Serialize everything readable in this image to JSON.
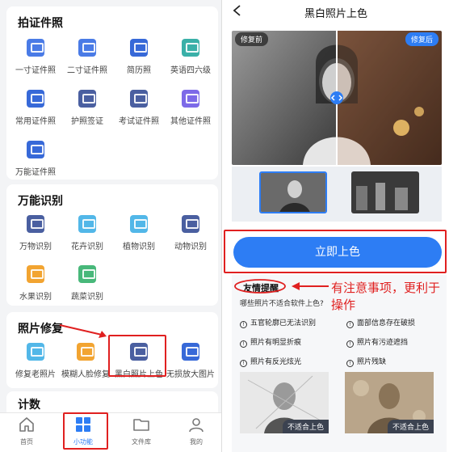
{
  "left": {
    "sections": [
      {
        "title": "拍证件照",
        "items": [
          {
            "label": "一寸证件照",
            "icon": "id-photo-icon",
            "color": "blue"
          },
          {
            "label": "二寸证件照",
            "icon": "id-photo-icon",
            "color": "blue"
          },
          {
            "label": "简历照",
            "icon": "resume-photo-icon",
            "color": "dblue"
          },
          {
            "label": "英语四六级",
            "icon": "exam-photo-icon",
            "color": "teal"
          },
          {
            "label": "常用证件照",
            "icon": "id-photo-icon",
            "color": "dblue"
          },
          {
            "label": "护照签证",
            "icon": "passport-icon",
            "color": "slate"
          },
          {
            "label": "考试证件照",
            "icon": "exam-photo-icon",
            "color": "slate"
          },
          {
            "label": "其他证件照",
            "icon": "add-photo-icon",
            "color": "purple"
          },
          {
            "label": "万能证件照",
            "icon": "universal-id-icon",
            "color": "dblue"
          }
        ]
      },
      {
        "title": "万能识别",
        "items": [
          {
            "label": "万物识别",
            "icon": "eye-icon",
            "color": "slate"
          },
          {
            "label": "花卉识别",
            "icon": "flower-icon",
            "color": "cyan"
          },
          {
            "label": "植物识别",
            "icon": "plant-icon",
            "color": "cyan"
          },
          {
            "label": "动物识别",
            "icon": "animal-icon",
            "color": "slate"
          },
          {
            "label": "水果识别",
            "icon": "fruit-icon",
            "color": "orange"
          },
          {
            "label": "蔬菜识别",
            "icon": "vegetable-icon",
            "color": "green"
          }
        ]
      },
      {
        "title": "照片修复",
        "items": [
          {
            "label": "修复老照片",
            "icon": "repair-photo-icon",
            "color": "cyan"
          },
          {
            "label": "模糊人脸修复",
            "icon": "face-repair-icon",
            "color": "orange"
          },
          {
            "label": "黑白照片上色",
            "icon": "colorize-icon",
            "color": "slate"
          },
          {
            "label": "无损放大图片",
            "icon": "zoom-image-icon",
            "color": "dblue"
          }
        ]
      },
      {
        "title": "计数",
        "items": []
      }
    ],
    "nav": [
      {
        "label": "首页",
        "icon": "home-icon"
      },
      {
        "label": "小功能",
        "icon": "grid-icon",
        "active": true
      },
      {
        "label": "文件库",
        "icon": "folder-icon"
      },
      {
        "label": "我的",
        "icon": "user-icon"
      }
    ]
  },
  "right": {
    "title": "黑白照片上色",
    "before_tag": "修复前",
    "after_tag": "修复后",
    "start_button": "立即上色",
    "tips": {
      "title": "友情提醒",
      "subtitle": "哪些照片不适合软件上色?",
      "items": [
        "五官轮廓已无法识别",
        "面部信息存在破损",
        "照片有明显折痕",
        "照片有污迹遮挡",
        "照片有反光炫光",
        "照片残缺"
      ],
      "bad_label": "不适合上色"
    }
  },
  "annotation": {
    "note": "有注意事项，更利于操作",
    "color": "#e02020"
  },
  "colors": {
    "accent": "#2d7df4",
    "annotation": "#e02020"
  }
}
